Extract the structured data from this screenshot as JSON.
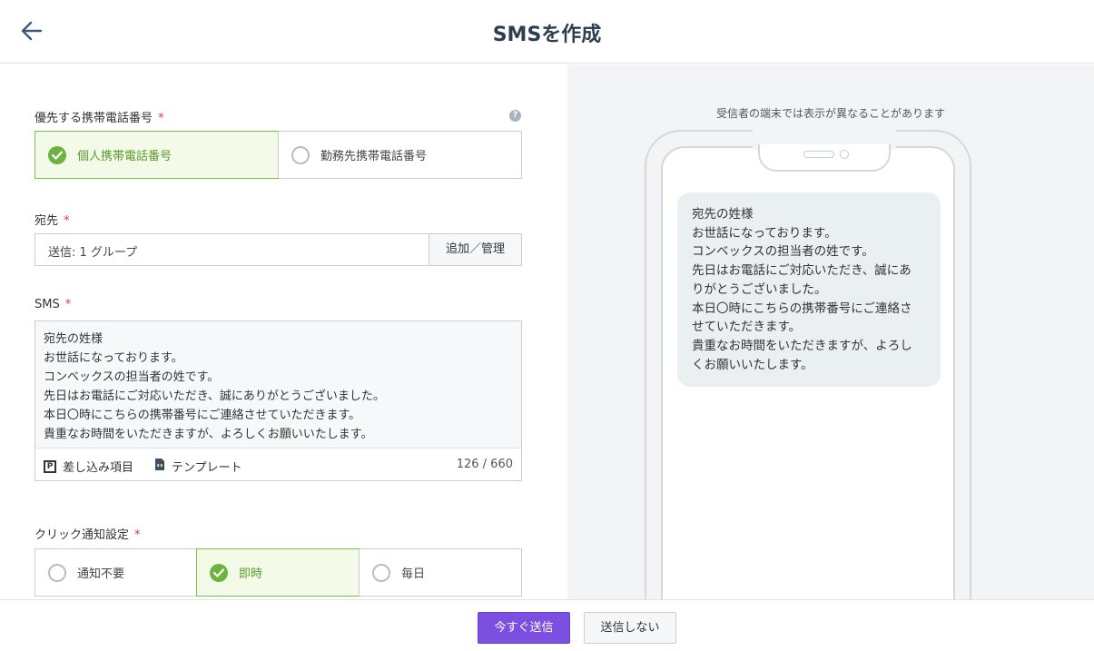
{
  "header": {
    "title": "SMSを作成"
  },
  "priority_phone": {
    "label": "優先する携帯電話番号",
    "required_mark": "*",
    "help": "?",
    "options": [
      {
        "label": "個人携帯電話番号",
        "selected": true
      },
      {
        "label": "勤務先携帯電話番号",
        "selected": false
      }
    ]
  },
  "recipient": {
    "label": "宛先",
    "required_mark": "*",
    "value": "送信: 1 グループ",
    "button_label": "追加／管理"
  },
  "sms": {
    "label": "SMS",
    "required_mark": "*",
    "lines": [
      "宛先の姓様",
      "お世話になっております。",
      "コンベックスの担当者の姓です。",
      "先日はお電話にご対応いただき、誠にありがとうございました。",
      "本日〇時にこちらの携帯番号にご連絡させていただきます。",
      "貴重なお時間をいただきますが、よろしくお願いいたします。"
    ],
    "insert_label": "差し込み項目",
    "template_label": "テンプレート",
    "counter": "126 / 660"
  },
  "click_notify": {
    "label": "クリック通知設定",
    "required_mark": "*",
    "options": [
      {
        "label": "通知不要",
        "selected": false
      },
      {
        "label": "即時",
        "selected": true
      },
      {
        "label": "毎日",
        "selected": false
      }
    ]
  },
  "preview": {
    "notice": "受信者の端末では表示が異なることがあります",
    "lines": [
      "宛先の姓様",
      "お世話になっております。",
      "コンベックスの担当者の姓です。",
      "先日はお電話にご対応いただき、誠にあ",
      "りがとうございました。",
      "本日〇時にこちらの携帯番号にご連絡さ",
      "せていただきます。",
      "貴重なお時間をいただきますが、よろし",
      "くお願いいたします。"
    ]
  },
  "actions": {
    "send_now": "今すぐ送信",
    "dont_send": "送信しない"
  },
  "colors": {
    "accent_purple": "#7b4fe0",
    "selected_green": "#6db33f",
    "required_red": "#e0364b",
    "title_navy": "#2d3e50"
  }
}
